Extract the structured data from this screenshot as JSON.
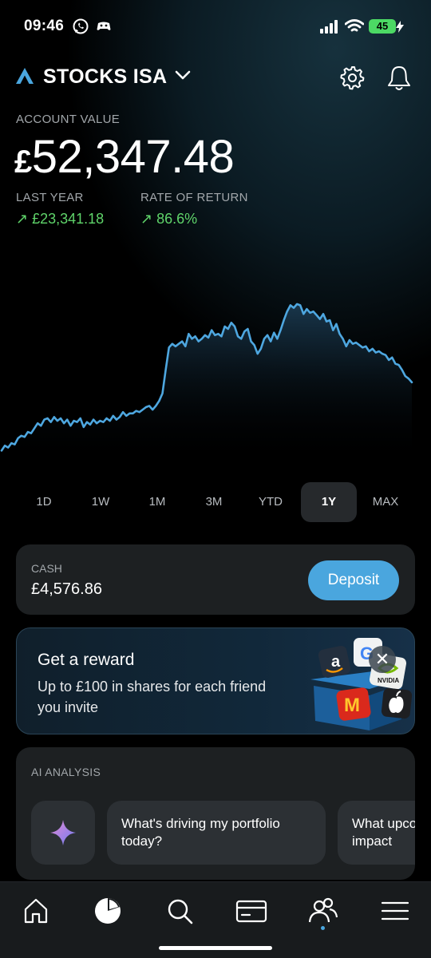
{
  "status_bar": {
    "time": "09:46",
    "battery": "45"
  },
  "header": {
    "account_name": "STOCKS ISA"
  },
  "summary": {
    "account_value_label": "ACCOUNT VALUE",
    "currency_symbol": "£",
    "account_value": "52,347.48",
    "last_year_label": "LAST YEAR",
    "last_year_value": "↗ £23,341.18",
    "rate_label": "RATE OF RETURN",
    "rate_value": "↗ 86.6%"
  },
  "chart_data": {
    "type": "area",
    "values": [
      0.0,
      0.08,
      0.05,
      0.12,
      0.1,
      0.2,
      0.24,
      0.22,
      0.3,
      0.28,
      0.36,
      0.44,
      0.4,
      0.5,
      0.52,
      0.46,
      0.54,
      0.48,
      0.52,
      0.44,
      0.5,
      0.4,
      0.48,
      0.46,
      0.52,
      0.38,
      0.46,
      0.42,
      0.5,
      0.44,
      0.48,
      0.46,
      0.52,
      0.48,
      0.56,
      0.5,
      0.54,
      0.62,
      0.56,
      0.6,
      0.6,
      0.64,
      0.62,
      0.66,
      0.7,
      0.72,
      0.66,
      0.72,
      0.8,
      0.92,
      1.3,
      1.66,
      1.72,
      1.68,
      1.72,
      1.76,
      1.68,
      1.88,
      1.8,
      1.84,
      1.76,
      1.8,
      1.86,
      1.82,
      1.94,
      1.86,
      1.88,
      1.84,
      2.0,
      1.96,
      2.06,
      2.0,
      1.84,
      1.8,
      1.92,
      1.96,
      1.76,
      1.7,
      1.56,
      1.64,
      1.8,
      1.86,
      1.76,
      1.9,
      1.8,
      1.94,
      2.1,
      2.24,
      2.34,
      2.3,
      2.36,
      2.34,
      2.2,
      2.28,
      2.22,
      2.24,
      2.18,
      2.12,
      2.2,
      2.08,
      2.1,
      1.94,
      2.04,
      1.88,
      1.8,
      1.68,
      1.78,
      1.72,
      1.74,
      1.7,
      1.66,
      1.68,
      1.6,
      1.64,
      1.58,
      1.6,
      1.56,
      1.54,
      1.46,
      1.5,
      1.4,
      1.38,
      1.3,
      1.2,
      1.16,
      1.1
    ],
    "ylim": [
      -0.2,
      2.5
    ],
    "grid": false,
    "colors": {
      "line": "#4ea7e0",
      "fill_top": "#1b3b52",
      "fill_bottom": "#000000"
    }
  },
  "ranges": {
    "tabs": [
      {
        "label": "1D",
        "active": false
      },
      {
        "label": "1W",
        "active": false
      },
      {
        "label": "1M",
        "active": false
      },
      {
        "label": "3M",
        "active": false
      },
      {
        "label": "YTD",
        "active": false
      },
      {
        "label": "1Y",
        "active": true
      },
      {
        "label": "MAX",
        "active": false
      }
    ]
  },
  "cash": {
    "label": "CASH",
    "value": "£4,576.86",
    "deposit_label": "Deposit"
  },
  "reward": {
    "title": "Get a reward",
    "subtitle": "Up to £100 in shares for each friend you invite",
    "close_label": "✕",
    "brand_letters": {
      "amazon": "a",
      "google": "G",
      "nvidia": "NVIDIA",
      "mcdonalds": "M",
      "apple": ""
    }
  },
  "ai": {
    "label": "AI ANALYSIS",
    "chips": [
      "What's driving my portfolio today?",
      "What upcoming events could impact"
    ]
  },
  "bottom_nav": {
    "items": [
      "home-icon",
      "portfolio-pie-icon",
      "search-icon",
      "card-icon",
      "friends-icon",
      "menu-icon"
    ],
    "active": "portfolio-pie-icon"
  },
  "colors": {
    "accent": "#4aa6de",
    "gain": "#5fd46a",
    "card": "#1d2022"
  }
}
